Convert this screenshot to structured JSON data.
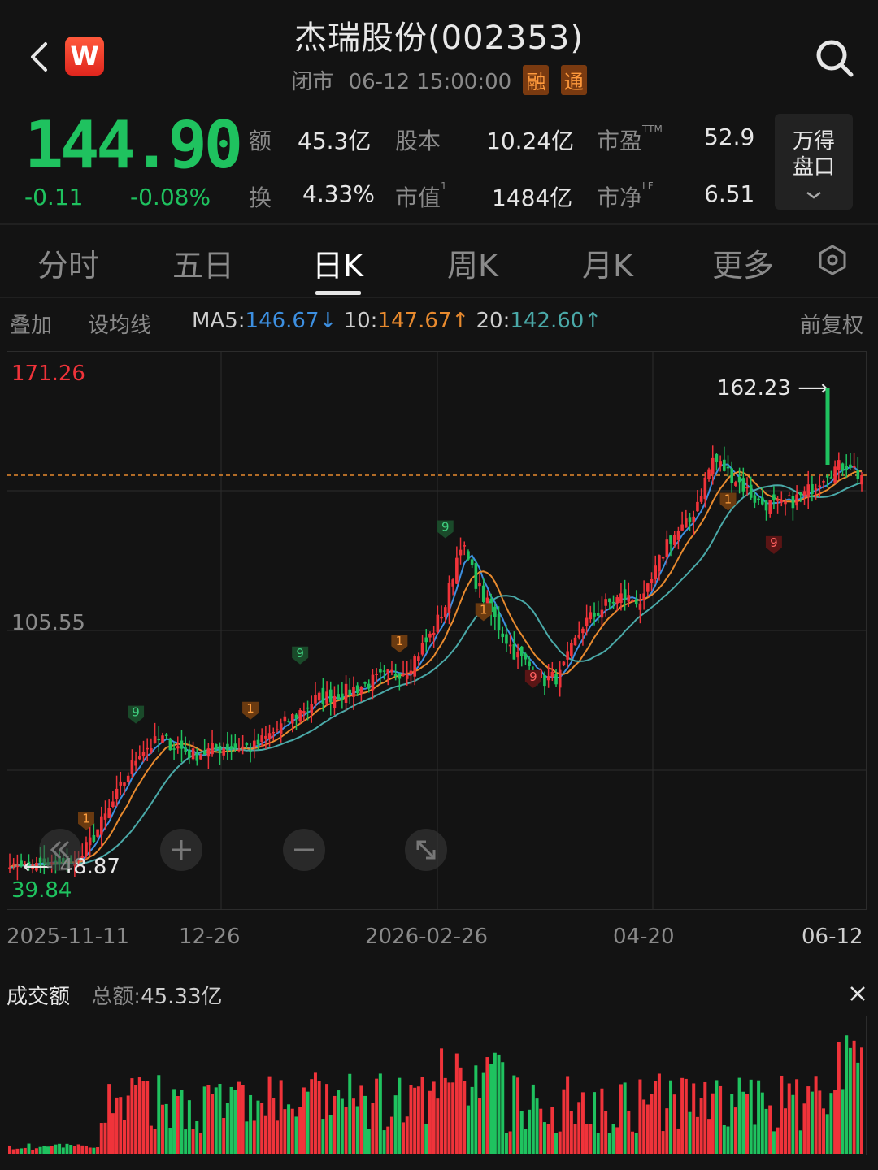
{
  "header": {
    "title": "杰瑞股份(002353)",
    "status": "闭市",
    "datetime": "06-12 15:00:00",
    "tags": [
      "融",
      "通"
    ]
  },
  "quote": {
    "price": "144.90",
    "change": "-0.11",
    "change_pct": "-0.08%",
    "stats": [
      {
        "label": "额",
        "value": "45.3亿"
      },
      {
        "label": "换",
        "value": "4.33%"
      },
      {
        "label": "股本",
        "value": "10.24亿"
      },
      {
        "label": "市值",
        "sup": "1",
        "value": "1484亿"
      },
      {
        "label": "市盈",
        "sup": "TTM",
        "value": "52.9"
      },
      {
        "label": "市净",
        "sup": "LF",
        "value": "6.51"
      }
    ],
    "order_book_label_1": "万得",
    "order_book_label_2": "盘口"
  },
  "tabs": [
    "分时",
    "五日",
    "日K",
    "周K",
    "月K",
    "更多"
  ],
  "active_tab": "日K",
  "toolbar": {
    "overlay": "叠加",
    "set_ma": "设均线",
    "ma5_label": "MA5",
    "ma5_value": "146.67",
    "ma10_label": "10",
    "ma10_value": "147.67",
    "ma20_label": "20",
    "ma20_value": "142.60",
    "adjust": "前复权"
  },
  "colors": {
    "up": "#f0333a",
    "down": "#1fc25f",
    "ma5": "#3d8fe0",
    "ma10": "#e88a2e",
    "ma20": "#4aa9a8",
    "dashed_line": "#e88a2e"
  },
  "chart_data": {
    "type": "candlestick",
    "y_axis_labels": [
      "171.26",
      "105.55",
      "39.84"
    ],
    "ylim": [
      39.84,
      171.26
    ],
    "high_marker": "162.23",
    "low_marker": "48.87",
    "current_price_line": 144.9,
    "x_labels": [
      "2025-11-11",
      "12-26",
      "2026-02-26",
      "04-20",
      "06-12"
    ],
    "signal_markers": [
      {
        "label": "1",
        "trading_day": 20,
        "price": 57
      },
      {
        "label": "9",
        "trading_day": 33,
        "price": 84
      },
      {
        "label": "1",
        "trading_day": 63,
        "price": 85
      },
      {
        "label": "9",
        "trading_day": 76,
        "price": 99
      },
      {
        "label": "1",
        "trading_day": 102,
        "price": 102
      },
      {
        "label": "9",
        "trading_day": 114,
        "price": 131
      },
      {
        "label": "1",
        "trading_day": 124,
        "price": 110
      },
      {
        "label": "9",
        "trading_day": 137,
        "price": 93
      },
      {
        "label": "1",
        "trading_day": 188,
        "price": 138
      },
      {
        "label": "9",
        "trading_day": 200,
        "price": 127
      }
    ],
    "series": [
      {
        "name": "MA5",
        "value": 146.67
      },
      {
        "name": "10",
        "value": 147.67
      },
      {
        "name": "20",
        "value": 142.6
      }
    ],
    "price_path": [
      [
        0,
        46
      ],
      [
        18,
        47
      ],
      [
        26,
        60
      ],
      [
        34,
        75
      ],
      [
        40,
        78
      ],
      [
        48,
        74
      ],
      [
        56,
        76
      ],
      [
        64,
        76
      ],
      [
        72,
        82
      ],
      [
        80,
        88
      ],
      [
        88,
        90
      ],
      [
        96,
        93
      ],
      [
        104,
        96
      ],
      [
        110,
        104
      ],
      [
        114,
        112
      ],
      [
        118,
        128
      ],
      [
        122,
        118
      ],
      [
        126,
        110
      ],
      [
        132,
        100
      ],
      [
        140,
        93
      ],
      [
        144,
        94
      ],
      [
        150,
        107
      ],
      [
        156,
        112
      ],
      [
        160,
        114
      ],
      [
        166,
        113
      ],
      [
        172,
        128
      ],
      [
        178,
        133
      ],
      [
        184,
        149
      ],
      [
        190,
        144
      ],
      [
        196,
        138
      ],
      [
        202,
        137
      ],
      [
        208,
        140
      ],
      [
        214,
        146
      ],
      [
        220,
        148
      ],
      [
        222,
        145
      ]
    ]
  },
  "volume": {
    "title": "成交额",
    "total_label": "总额",
    "total_value": "45.33亿",
    "max_value": 66
  }
}
